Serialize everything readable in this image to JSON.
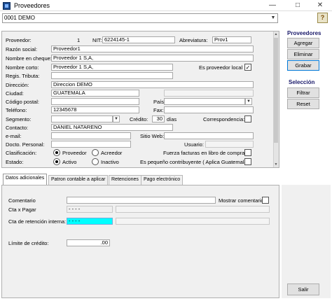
{
  "window": {
    "title": "Proveedores",
    "controls": {
      "minimize": "—",
      "maximize": "□",
      "close": "✕"
    }
  },
  "company": {
    "value": "0001  DEMO"
  },
  "form": {
    "proveedor_label": "Proveedor:",
    "proveedor_value": "1",
    "nit_label": "NIT:",
    "nit_value": "6224145-1",
    "abreviatura_label": "Abreviatura:",
    "abreviatura_value": "Prov1",
    "razon_label": "Razón social:",
    "razon_value": "Proveedor1",
    "cheque_label": "Nombre en cheque:",
    "cheque_value": "Proveedor 1 S,A,",
    "corto_label": "Nombre corto:",
    "corto_value": "Proveedor 1 S,A,",
    "es_local_label": "Es proveedor local :",
    "es_local_checked": "✓",
    "regis_label": "Regis. Tributa:",
    "regis_value": "",
    "direccion_label": "Dirección:",
    "direccion_value": "Direccion DEMO",
    "ciudad_label": "Ciudad:",
    "ciudad_value": "GUATEMALA",
    "codigo_label": "Código postal:",
    "codigo_value": "",
    "pais_label": "País:",
    "pais_value": "",
    "telefono_label": "Teléfono:",
    "telefono_value": "12345678",
    "fax_label": "Fax:",
    "fax_value": "",
    "segmento_label": "Segmento:",
    "segmento_value": "",
    "credito_label": "Crédito:",
    "credito_value": "30",
    "dias_label": "días",
    "correspondencia_label": "Correspondencia:",
    "contacto_label": "Contacto:",
    "contacto_value": "DANIEL NATARENO",
    "email_label": "e-mail:",
    "email_value": "",
    "sitio_label": "Sitio Web:",
    "sitio_value": "",
    "docto_label": "Docto. Personal:",
    "docto_value": "",
    "usuario_label": "Usuario:",
    "usuario_value": "",
    "clasificacion_label": "Clasificación:",
    "proveedor_radio": "Proveedor",
    "acreedor_radio": "Acreedor",
    "fuerza_label": "Fuerza facturas en libro de compras",
    "estado_label": "Estado:",
    "activo_radio": "Activo",
    "inactivo_radio": "Inactivo",
    "peq_label": "Es pequeño contribuyente ( Aplica Guatemala)"
  },
  "proveedores_group": {
    "title": "Proveedores",
    "agregar": "Agregar",
    "eliminar": "Eliminar",
    "grabar": "Grabar"
  },
  "seleccion_group": {
    "title": "Selección",
    "filtrar": "Filtrar",
    "reset": "Reset"
  },
  "tabs": [
    "Datos adicionales",
    "Patron contable a aplicar",
    "Retenciones",
    "Pago electrónico"
  ],
  "datos": {
    "comentario_label": "Comentario",
    "comentario_value": "",
    "mostrar_label": "Mostrar comentario:",
    "cta_pagar_label": "Cta x Pagar",
    "cta_pagar_value": "-  -  -  -",
    "cta_ret_label": "Cta de retención interna:",
    "cta_ret_value": "-  -  -  -",
    "limite_label": "Límite de crédito:",
    "limite_value": ".00"
  },
  "salir": "Salir",
  "colors": {
    "highlight_field": "#00ffff",
    "accent": "#0078d7"
  }
}
